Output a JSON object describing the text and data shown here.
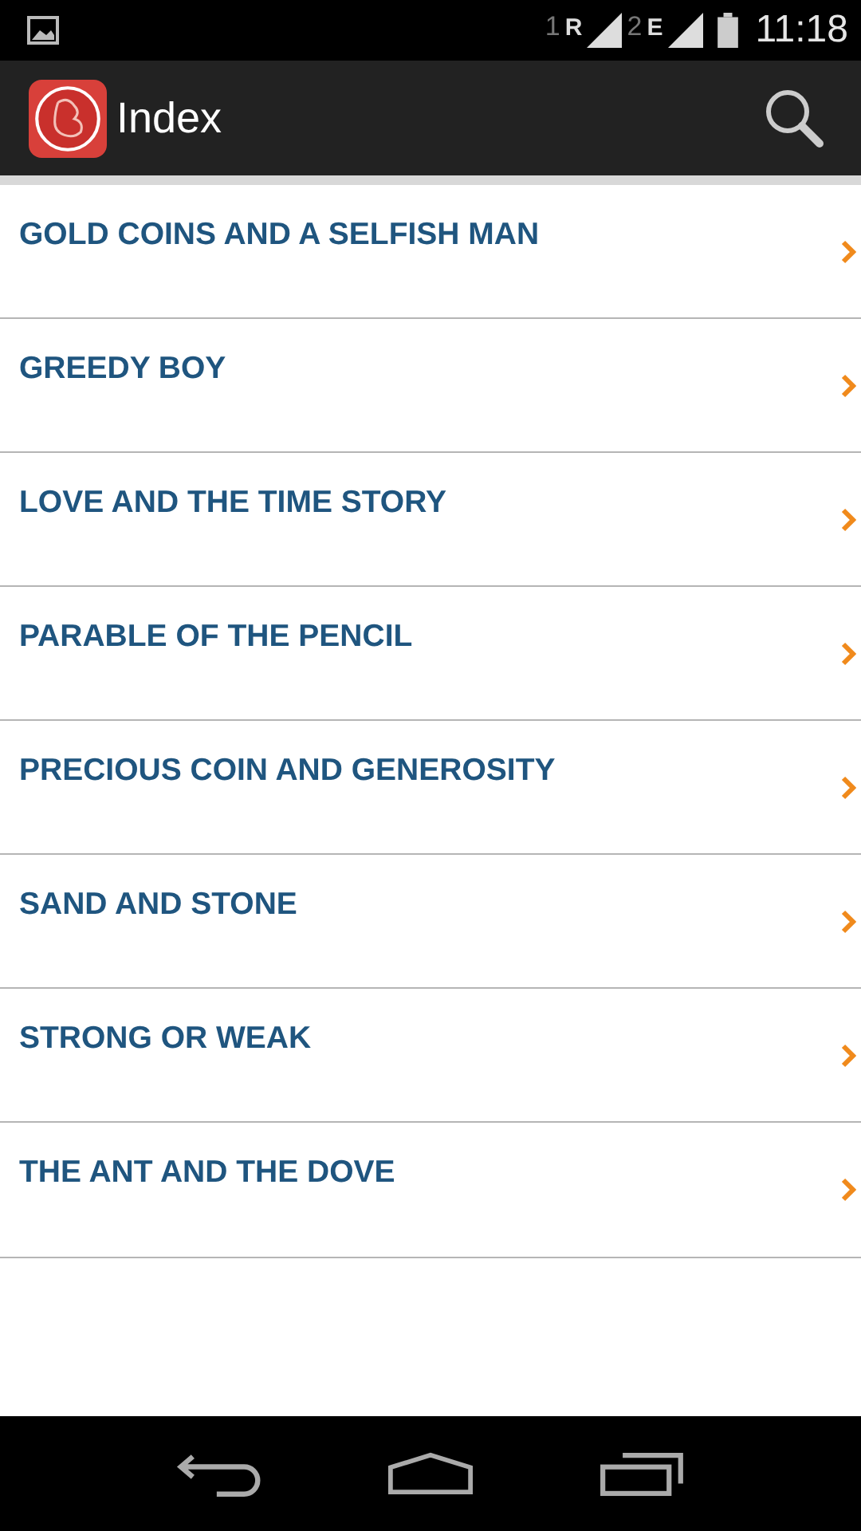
{
  "status_bar": {
    "sim1": "1",
    "roaming": "R",
    "sim2": "2",
    "network": "E",
    "time": "11:18"
  },
  "action_bar": {
    "title": "Index"
  },
  "items": [
    {
      "title": "GOLD COINS AND A SELFISH MAN"
    },
    {
      "title": "GREEDY BOY"
    },
    {
      "title": "LOVE AND THE TIME STORY"
    },
    {
      "title": "PARABLE OF THE PENCIL"
    },
    {
      "title": "PRECIOUS COIN AND GENEROSITY"
    },
    {
      "title": "SAND AND STONE"
    },
    {
      "title": "STRONG OR WEAK"
    },
    {
      "title": "THE ANT AND THE DOVE"
    }
  ]
}
